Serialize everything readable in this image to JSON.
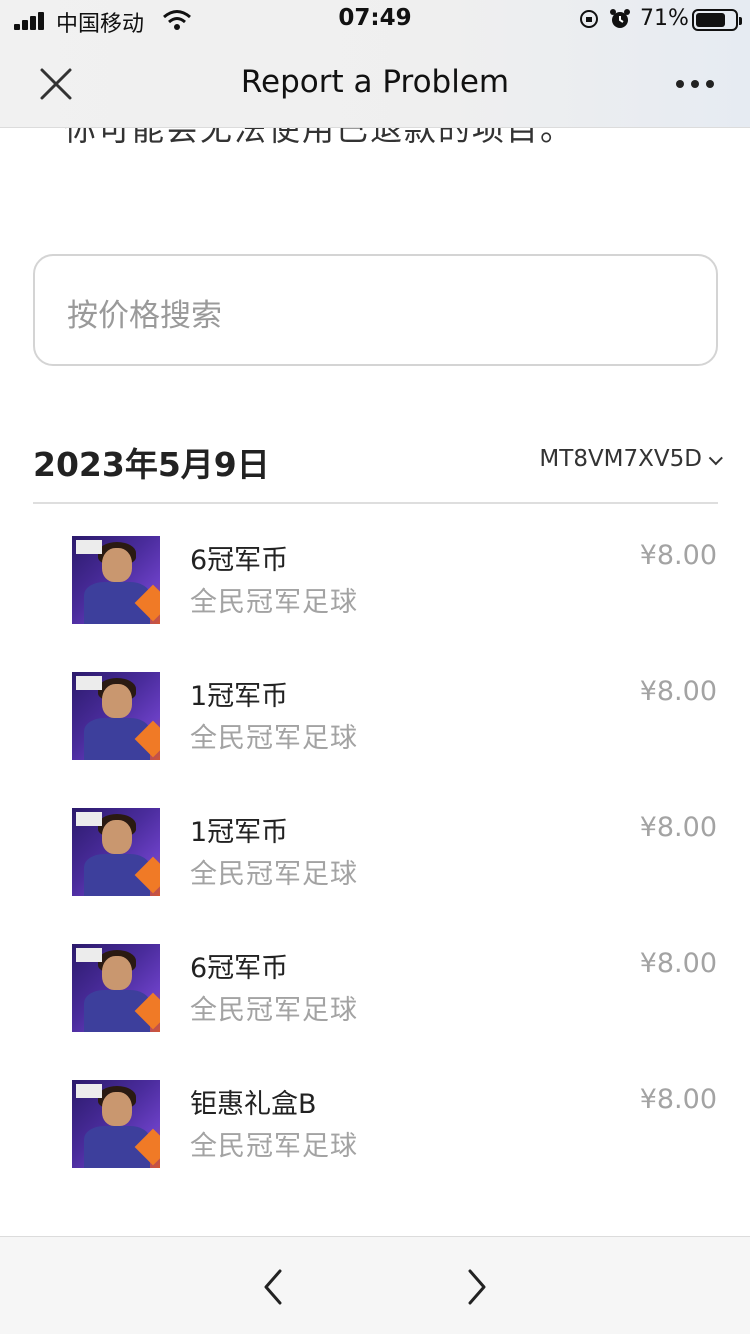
{
  "status_bar": {
    "carrier": "中国移动",
    "time": "07:49",
    "battery_percent": "71%",
    "battery_level": 0.71
  },
  "header": {
    "title": "Report a Problem"
  },
  "intro_text": "你可能会无法使用已退款的项目。",
  "search": {
    "placeholder": "按价格搜索"
  },
  "date_group": {
    "date": "2023年5月9日",
    "order_id": "MT8VM7XV5D"
  },
  "items": [
    {
      "name": "6冠军币",
      "app": "全民冠军足球",
      "price": "¥8.00"
    },
    {
      "name": "1冠军币",
      "app": "全民冠军足球",
      "price": "¥8.00"
    },
    {
      "name": "1冠军币",
      "app": "全民冠军足球",
      "price": "¥8.00"
    },
    {
      "name": "6冠军币",
      "app": "全民冠军足球",
      "price": "¥8.00"
    },
    {
      "name": "钜惠礼盒B",
      "app": "全民冠军足球",
      "price": "¥8.00"
    }
  ],
  "icons": {
    "close": "close-icon",
    "more": "more-icon",
    "back": "chevron-left-icon",
    "forward": "chevron-right-icon"
  }
}
